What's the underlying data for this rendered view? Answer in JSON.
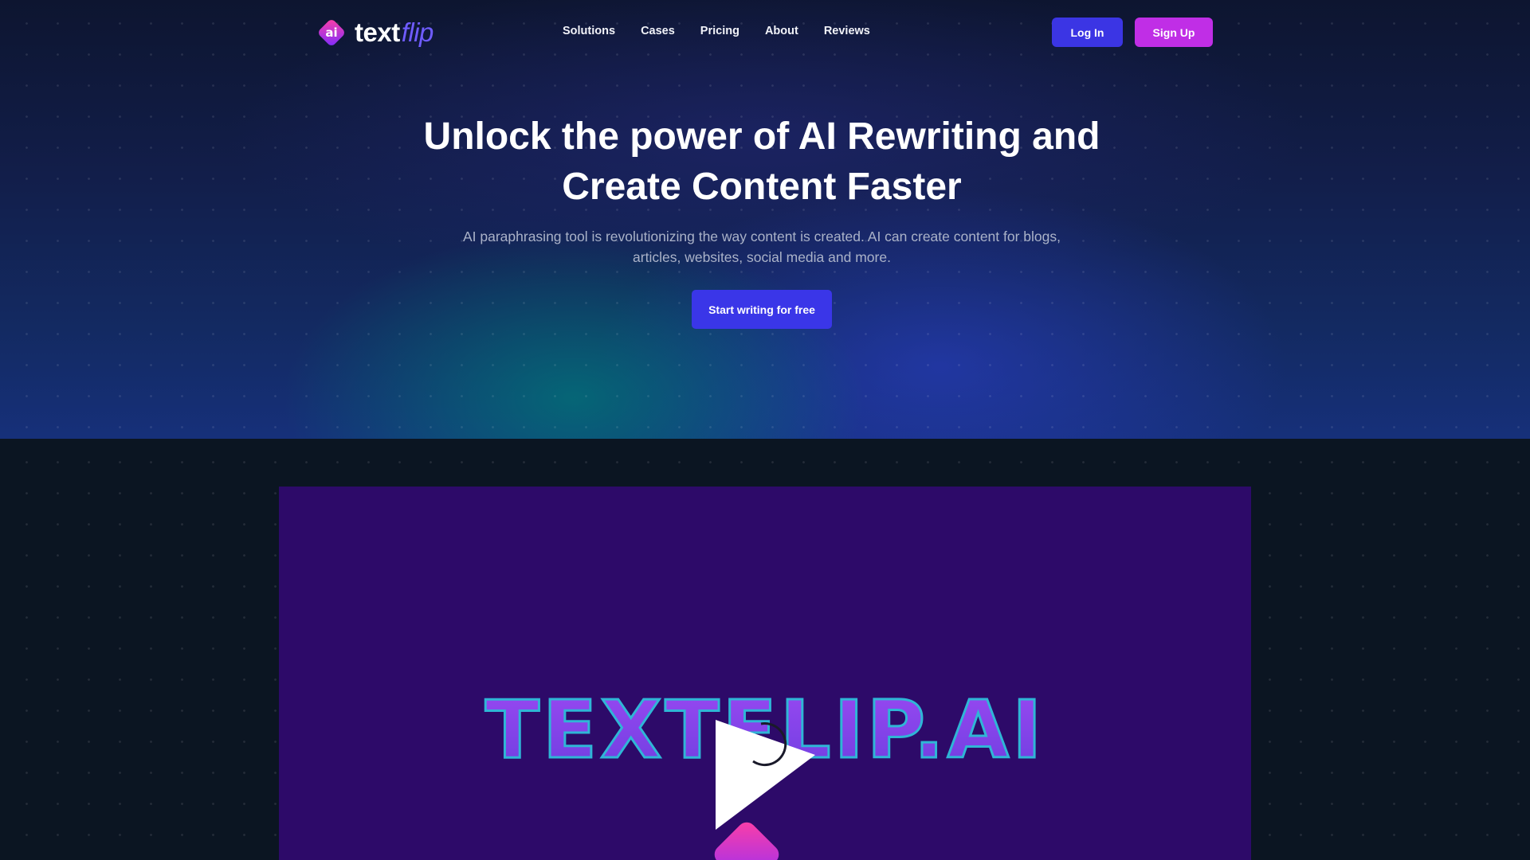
{
  "brand": {
    "logo_badge": "ai",
    "name_main": "text",
    "name_accent": "flip"
  },
  "nav": {
    "items": [
      {
        "label": "Solutions"
      },
      {
        "label": "Cases"
      },
      {
        "label": "Pricing"
      },
      {
        "label": "About"
      },
      {
        "label": "Reviews"
      }
    ],
    "login_label": "Log In",
    "signup_label": "Sign Up"
  },
  "hero": {
    "headline_line1": "Unlock the power of AI Rewriting and",
    "headline_line2": "Create Content Faster",
    "subtext_line1": "AI paraphrasing tool is revolutionizing the way content is created. AI can create content for blogs,",
    "subtext_line2": "articles, websites, social media and more.",
    "cta_label": "Start writing for free"
  },
  "video": {
    "overlay_text": "TEXTFLIP.AI",
    "play_icon": "play-icon",
    "loading_icon": "spinner-icon"
  },
  "colors": {
    "login_button": "#3b35e4",
    "signup_button": "#c02ee6",
    "cta_button": "#3a36e8",
    "video_background": "#2d0a69",
    "page_background": "#0b1522",
    "brand_accent": "#6f5cff"
  }
}
